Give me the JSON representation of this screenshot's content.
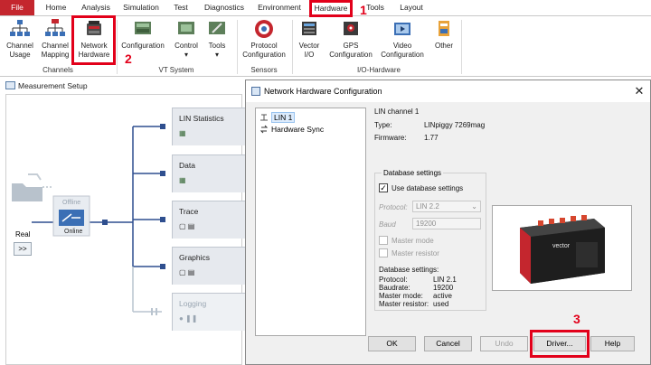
{
  "ribbon": {
    "tabs": [
      "File",
      "Home",
      "Analysis",
      "Simulation",
      "Test",
      "Diagnostics",
      "Environment",
      "Hardware",
      "Tools",
      "Layout"
    ],
    "active_tab": "Hardware",
    "buttons": {
      "channel_usage": [
        "Channel",
        "Usage"
      ],
      "channel_mapping": [
        "Channel",
        "Mapping"
      ],
      "network_hardware": [
        "Network",
        "Hardware"
      ],
      "configuration": "Configuration",
      "control": "Control",
      "tools": "Tools",
      "protocol_configuration": [
        "Protocol",
        "Configuration"
      ],
      "vector_io": [
        "Vector",
        "I/O"
      ],
      "gps_configuration": [
        "GPS",
        "Configuration"
      ],
      "video_configuration": [
        "Video",
        "Configuration"
      ],
      "other": "Other"
    },
    "groups": [
      "Channels",
      "VT System",
      "Sensors",
      "I/O-Hardware"
    ]
  },
  "annotations": [
    "1",
    "2",
    "3"
  ],
  "measurement_setup": {
    "title": "Measurement Setup",
    "offline_label": "Offline",
    "online_label": "Online",
    "real_label": "Real",
    "real_button": ">>",
    "blocks": [
      "LIN Statistics",
      "Data",
      "Trace",
      "Graphics",
      "Logging"
    ]
  },
  "dialog": {
    "title": "Network Hardware Configuration",
    "close": "✕",
    "tree": [
      "LIN 1",
      "Hardware Sync"
    ],
    "channel_heading": "LIN channel 1",
    "type_label": "Type:",
    "type_value": "LINpiggy 7269mag",
    "firmware_label": "Firmware:",
    "firmware_value": "1.77",
    "db_group_label": "Database settings",
    "use_db_label": "Use database settings",
    "use_db_checked": true,
    "protocol_label": "Protocol:",
    "protocol_value": "LIN 2.2",
    "baud_label": "Baud",
    "baud_value": "19200",
    "master_mode_label": "Master mode",
    "master_resistor_label": "Master resistor",
    "db_summary_heading": "Database settings:",
    "db_summary": [
      [
        "Protocol:",
        "LIN 2.1"
      ],
      [
        "Baudrate:",
        "19200"
      ],
      [
        "Master mode:",
        "active"
      ],
      [
        "Master resistor:",
        "used"
      ]
    ],
    "buttons": {
      "ok": "OK",
      "cancel": "Cancel",
      "undo": "Undo",
      "driver": "Driver...",
      "help": "Help"
    },
    "photo_brand": "vector"
  },
  "colors": {
    "file_tab": "#c4262e",
    "highlight": "#e2001a",
    "connector": "#2f4f8f"
  }
}
